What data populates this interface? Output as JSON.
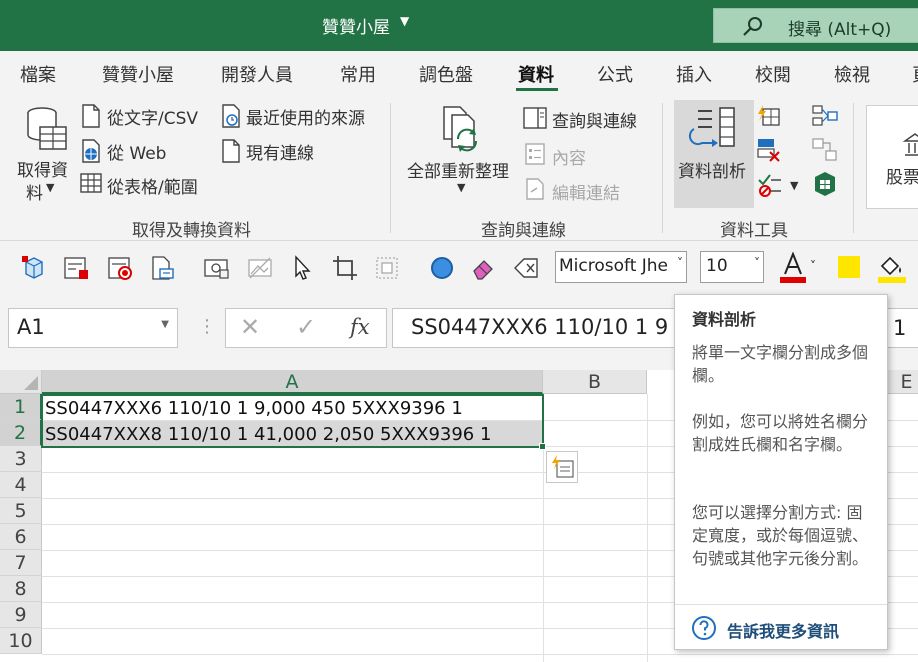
{
  "window": {
    "title": "贊贊小屋",
    "search_placeholder": "搜尋 (Alt+Q)"
  },
  "tabs": [
    {
      "label": "檔案"
    },
    {
      "label": "贊贊小屋"
    },
    {
      "label": "開發人員"
    },
    {
      "label": "常用"
    },
    {
      "label": "調色盤"
    },
    {
      "label": "資料",
      "active": true
    },
    {
      "label": "公式"
    },
    {
      "label": "插入"
    },
    {
      "label": "校閱"
    },
    {
      "label": "檢視"
    },
    {
      "label": "頁"
    }
  ],
  "ribbon": {
    "get_data": {
      "get_data_line1": "取得資",
      "get_data_line2": "料",
      "from_text_csv": "從文字/CSV",
      "from_web": "從 Web",
      "from_table": "從表格/範圍",
      "recent_sources": "最近使用的來源",
      "existing_connections": "現有連線",
      "label": "取得及轉換資料"
    },
    "queries": {
      "refresh_all": "全部重新整理",
      "queries_connections": "查詢與連線",
      "properties": "內容",
      "edit_links": "編輯連結",
      "label": "查詢與連線"
    },
    "data_tools": {
      "text_to_columns": "資料剖析",
      "label": "資料工具"
    },
    "stocks": "股票"
  },
  "qat": {
    "font_name": "Microsoft Jhe",
    "font_size": "10"
  },
  "formula_bar": {
    "name_box": "A1",
    "cancel": "✕",
    "enter": "✓",
    "fx": "fx",
    "content": "SS0447XXX6 110/10 1 9"
  },
  "grid": {
    "columns": [
      "A",
      "B",
      "E"
    ],
    "rows": [
      "1",
      "2",
      "3",
      "4",
      "5",
      "6",
      "7",
      "8",
      "9",
      "10"
    ],
    "cells": {
      "A1": "SS0447XXX6 110/10 1 9,000 450 5XXX9396 1",
      "A2": "SS0447XXX8 110/10 1 41,000 2,050 5XXX9396 1"
    },
    "right_partial": "1"
  },
  "tooltip": {
    "title": "資料剖析",
    "para1": "將單一文字欄分割成多個欄。",
    "para2": "例如，您可以將姓名欄分割成姓氏欄和名字欄。",
    "para3": "您可以選擇分割方式: 固定寬度，或於每個逗號、句號或其他字元後分割。",
    "link": "告訴我更多資訊"
  },
  "colors": {
    "excel_green": "#217346",
    "font_color_bar": "#e00000",
    "highlight_yellow": "#ffe600"
  }
}
